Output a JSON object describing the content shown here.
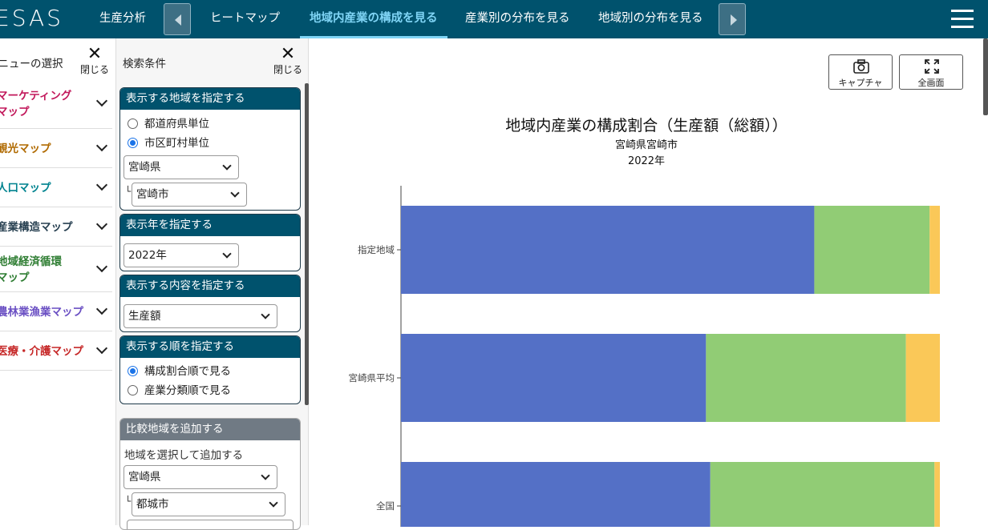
{
  "header": {
    "logo": "ESAS",
    "nav": [
      "生産分析",
      "ヒートマップ",
      "地域内産業の構成を見る",
      "産業別の分布を見る",
      "地域別の分布を見る"
    ],
    "active_tab": "地域内産業の構成を見る"
  },
  "menu_panel": {
    "title": "メニューの選択",
    "close_label": "閉じる",
    "items": [
      {
        "label": "マーケティング\nマップ",
        "color": "#c2185b"
      },
      {
        "label": "観光マップ",
        "color": "#b06a00"
      },
      {
        "label": "人口マップ",
        "color": "#00838f"
      },
      {
        "label": "産業構造マップ",
        "color": "#263f50"
      },
      {
        "label": "地域経済循環\nマップ",
        "color": "#2e7d32"
      },
      {
        "label": "農林業漁業マップ",
        "color": "#6a4fc3"
      },
      {
        "label": "医療・介護マップ",
        "color": "#c62828"
      }
    ]
  },
  "search_panel": {
    "title": "検索条件",
    "close_label": "閉じる",
    "region": {
      "heading": "表示する地域を指定する",
      "option_prefecture": "都道府県単位",
      "option_city": "市区町村単位",
      "prefecture": "宮崎県",
      "city": "宮崎市",
      "indent": "└"
    },
    "year": {
      "heading": "表示年を指定する",
      "value": "2022年"
    },
    "content": {
      "heading": "表示する内容を指定する",
      "value": "生産額"
    },
    "order": {
      "heading": "表示する順を指定する",
      "option_ratio": "構成割合順で見る",
      "option_class": "産業分類順で見る"
    },
    "compare": {
      "heading": "比較地域を追加する",
      "label": "地域を選択して追加する",
      "prefecture": "宮崎県",
      "city": "都城市",
      "indent": "└"
    }
  },
  "toolbar": {
    "capture_label": "キャプチャ",
    "fullscreen_label": "全画面"
  },
  "chart_data": {
    "type": "bar",
    "orientation": "horizontal",
    "stacked": true,
    "title": "地域内産業の構成割合（生産額（総額））",
    "subtitle": "宮崎県宮崎市",
    "subtitle2": "2022年",
    "categories": [
      "指定地域",
      "宮崎県平均",
      "全国"
    ],
    "series": [
      {
        "values": [
          76.7,
          56.6,
          57.4
        ],
        "color": "#5470c6"
      },
      {
        "values": [
          21.4,
          37.1,
          41.6
        ],
        "color": "#91cc75"
      },
      {
        "values": [
          1.9,
          6.3,
          1.0
        ],
        "color": "#fac858"
      }
    ],
    "xlim": [
      0,
      100
    ]
  }
}
